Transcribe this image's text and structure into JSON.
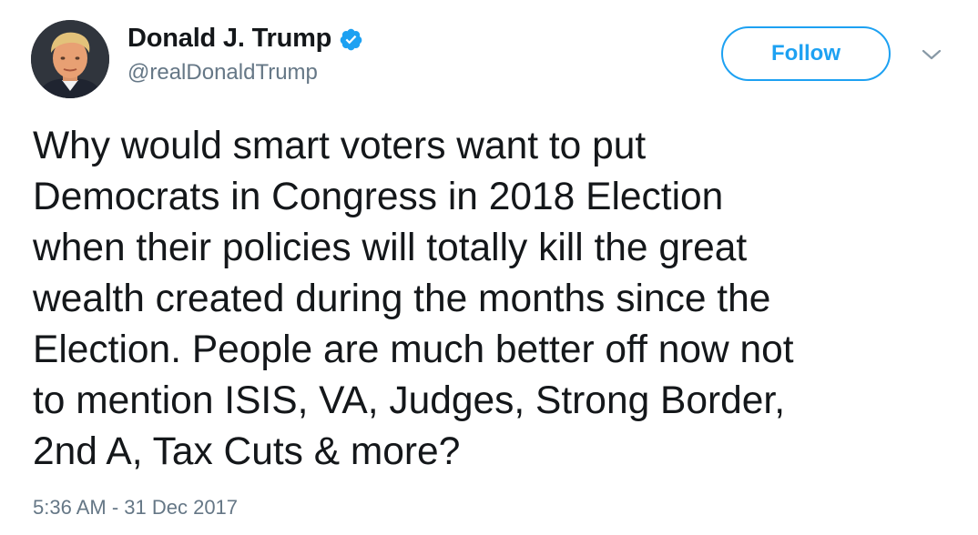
{
  "user": {
    "display_name": "Donald J. Trump",
    "handle": "@realDonaldTrump",
    "verified": true
  },
  "actions": {
    "follow_label": "Follow"
  },
  "tweet": {
    "lines": [
      "Why would smart voters want to put",
      "Democrats in Congress in 2018 Election",
      "when their policies will totally kill the great",
      "wealth created during the months since the",
      "Election. People are much better off now not",
      "to mention ISIS, VA, Judges, Strong Border,",
      "2nd A, Tax Cuts & more?"
    ],
    "timestamp": "5:36 AM - 31 Dec 2017"
  },
  "icons": {
    "verified": "verified-badge-icon",
    "caret": "chevron-down-icon"
  },
  "colors": {
    "accent": "#1da1f2",
    "text_primary": "#14171a",
    "text_secondary": "#657786",
    "background": "#ffffff"
  }
}
